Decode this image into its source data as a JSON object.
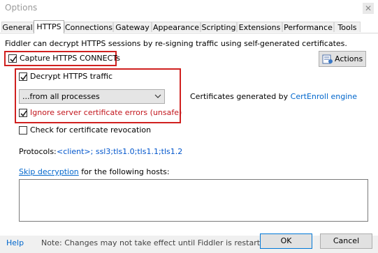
{
  "window": {
    "title": "Options"
  },
  "tabs": [
    {
      "label": "General"
    },
    {
      "label": "HTTPS"
    },
    {
      "label": "Connections"
    },
    {
      "label": "Gateway"
    },
    {
      "label": "Appearance"
    },
    {
      "label": "Scripting"
    },
    {
      "label": "Extensions"
    },
    {
      "label": "Performance"
    },
    {
      "label": "Tools"
    }
  ],
  "https": {
    "description": "Fiddler can decrypt HTTPS sessions by re-signing traffic using self-generated certificates.",
    "capture_label": "Capture HTTPS CONNECTs",
    "capture_checked": true,
    "actions_label": "Actions",
    "decrypt_label": "Decrypt HTTPS traffic",
    "decrypt_checked": true,
    "process_selected": "...from all processes",
    "cert_prefix": "Certificates generated by ",
    "cert_link": "CertEnroll engine",
    "ignore_label": "Ignore server certificate errors (unsafe)",
    "ignore_checked": true,
    "revocation_label": "Check for certificate revocation",
    "revocation_checked": false,
    "protocols_label": "Protocols:",
    "protocols_value": "<client>; ssl3;tls1.0;tls1.1;tls1.2",
    "skip_link": "Skip decryption",
    "skip_suffix": " for the following hosts:",
    "skip_hosts": ""
  },
  "footer": {
    "help_label": "Help",
    "note": "Note: Changes may not take effect until Fiddler is restarted.",
    "ok_label": "OK",
    "cancel_label": "Cancel"
  },
  "colors": {
    "highlight_box": "#d0201f",
    "link": "#0066cc",
    "warning_text": "#c2151c"
  }
}
